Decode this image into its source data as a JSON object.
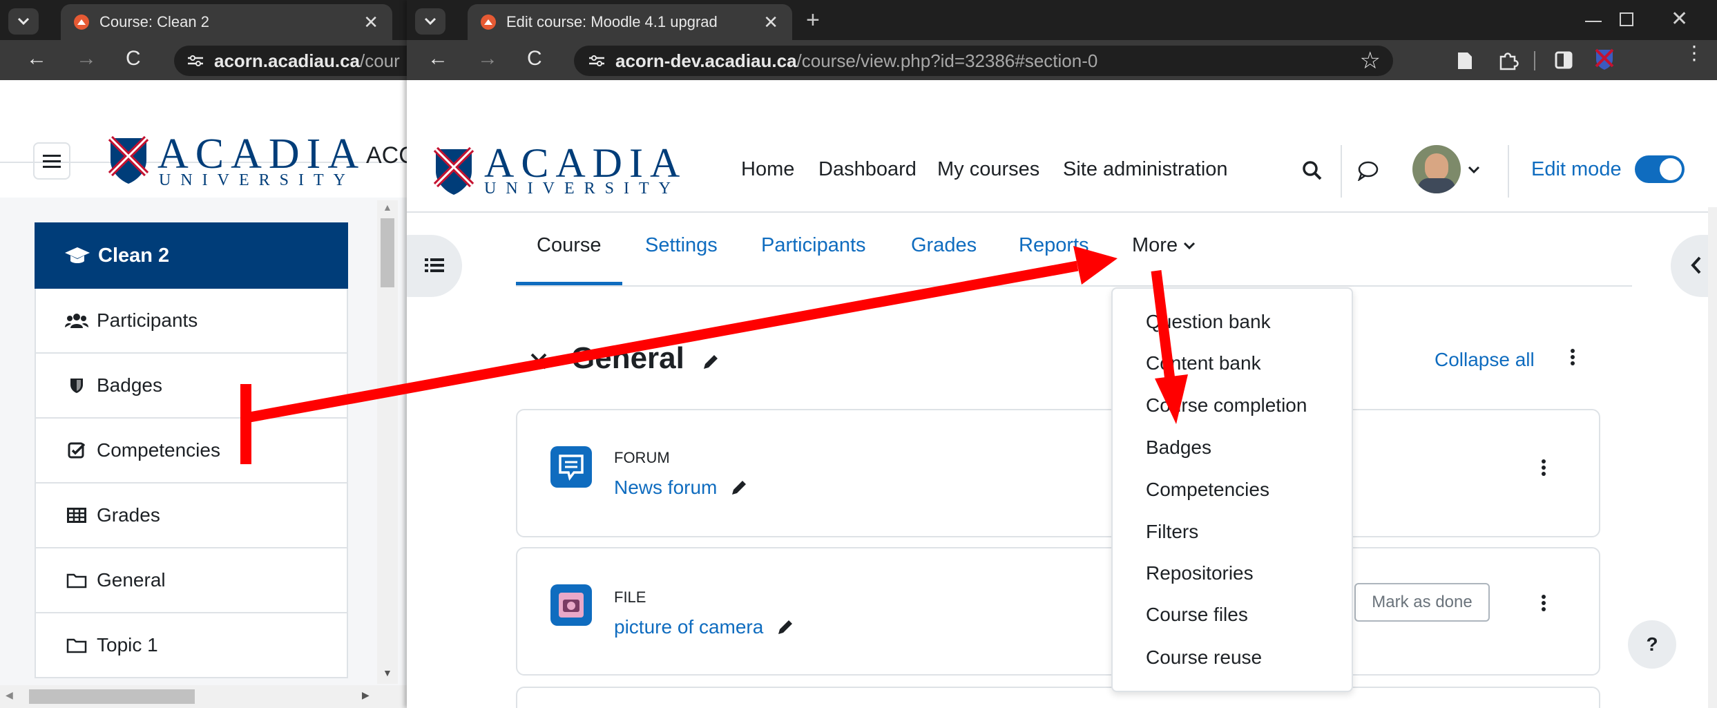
{
  "colors": {
    "acadia_blue": "#003d79",
    "acadia_red": "#c41230",
    "moodle_link": "#0f6cbf",
    "arrow_red": "#ff0000",
    "chrome_dark": "#1f1f1f",
    "chrome_tab": "#3a3a3a"
  },
  "back_window": {
    "tab_title": "Course: Clean 2",
    "address_host": "acorn.acadiau.ca",
    "address_path": "/cour",
    "logo": {
      "name": "ACADIA",
      "sub": "UNIVERSITY"
    },
    "header_cut_text": "ACC",
    "course_title": "Clean 2",
    "sidebar_items": [
      {
        "label": "Participants",
        "icon": "users-icon"
      },
      {
        "label": "Badges",
        "icon": "shield-icon"
      },
      {
        "label": "Competencies",
        "icon": "check-square-icon"
      },
      {
        "label": "Grades",
        "icon": "table-icon"
      },
      {
        "label": "General",
        "icon": "folder-icon"
      },
      {
        "label": "Topic 1",
        "icon": "folder-icon"
      }
    ]
  },
  "front_window": {
    "tab_title": "Edit course: Moodle 4.1 upgrad",
    "address_host": "acorn-dev.acadiau.ca",
    "address_path": "/course/view.php?id=32386#section-0",
    "logo": {
      "name": "ACADIA",
      "sub": "UNIVERSITY"
    },
    "nav": {
      "home": "Home",
      "dashboard": "Dashboard",
      "my_courses": "My courses",
      "site_admin": "Site administration"
    },
    "edit_mode_label": "Edit mode",
    "edit_mode_on": true,
    "secondary_tabs": [
      "Course",
      "Settings",
      "Participants",
      "Grades",
      "Reports"
    ],
    "more_label": "More",
    "more_menu_items": [
      "Question bank",
      "Content bank",
      "Course completion",
      "Badges",
      "Competencies",
      "Filters",
      "Repositories",
      "Course files",
      "Course reuse"
    ],
    "section_title": "General",
    "collapse_all": "Collapse all",
    "activities": [
      {
        "type": "FORUM",
        "name": "News forum",
        "icon": "forum-icon"
      },
      {
        "type": "FILE",
        "name": "picture of camera",
        "icon": "file-image-icon",
        "action": "Mark as done"
      }
    ],
    "help": "?"
  }
}
